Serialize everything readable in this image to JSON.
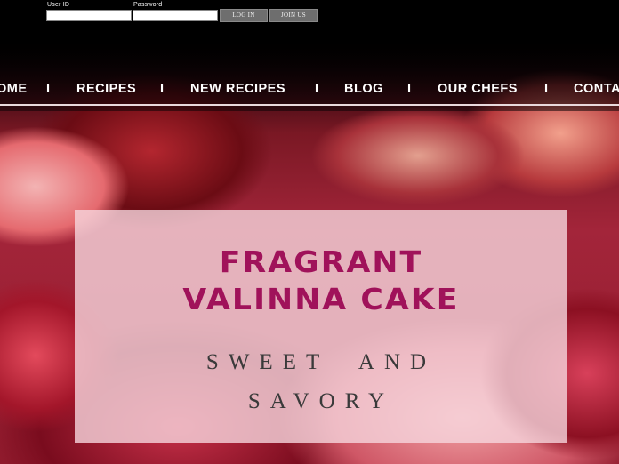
{
  "login": {
    "user_id_label": "User ID",
    "password_label": "Password",
    "user_id_value": "",
    "password_value": "",
    "login_button": "LOG IN",
    "join_button": "JOIN US"
  },
  "nav": {
    "items": [
      "OME",
      "RECIPES",
      "NEW RECIPES",
      "BLOG",
      "OUR CHEFS",
      "CONTA"
    ],
    "separator": "I"
  },
  "hero": {
    "title_line1": "FRAGRANT",
    "title_line2": "VALINNA CAKE",
    "subtitle_line1": "SWEET  AND",
    "subtitle_line2": "SAVORY"
  },
  "colors": {
    "title": "#a0125a",
    "panel": "#f6d6dd",
    "background": "#000000"
  }
}
